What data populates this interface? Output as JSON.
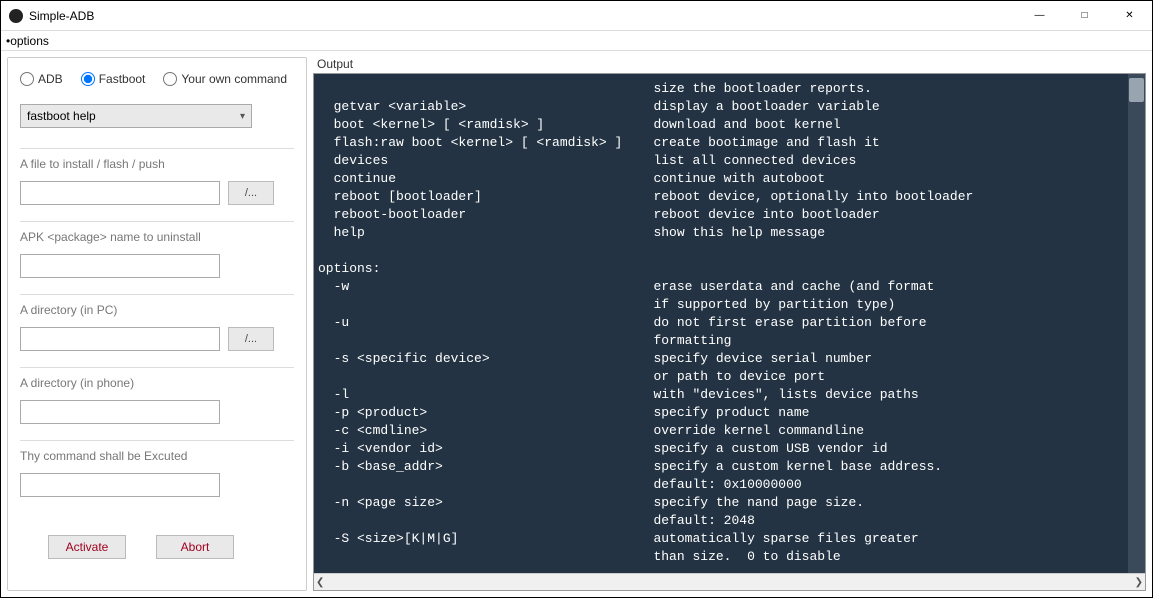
{
  "window": {
    "title": "Simple-ADB",
    "menu": "options"
  },
  "left": {
    "radios": {
      "adb": "ADB",
      "fastboot": "Fastboot",
      "own": "Your own command",
      "selected": "fastboot"
    },
    "combo": "fastboot help",
    "groups": {
      "file": {
        "label": "A file to install / flash / push",
        "browse": "/..."
      },
      "apk": {
        "label": "APK <package> name to uninstall"
      },
      "dirpc": {
        "label": "A directory (in PC)",
        "browse": "/..."
      },
      "dirphone": {
        "label": "A directory (in phone)"
      },
      "cmd": {
        "label": "Thy command shall be Excuted"
      }
    },
    "buttons": {
      "activate": "Activate",
      "abort": "Abort"
    }
  },
  "output": {
    "label": "Output",
    "text": "                                           size the bootloader reports.\n  getvar <variable>                        display a bootloader variable\n  boot <kernel> [ <ramdisk> ]              download and boot kernel\n  flash:raw boot <kernel> [ <ramdisk> ]    create bootimage and flash it\n  devices                                  list all connected devices\n  continue                                 continue with autoboot\n  reboot [bootloader]                      reboot device, optionally into bootloader\n  reboot-bootloader                        reboot device into bootloader\n  help                                     show this help message\n\noptions:\n  -w                                       erase userdata and cache (and format\n                                           if supported by partition type)\n  -u                                       do not first erase partition before\n                                           formatting\n  -s <specific device>                     specify device serial number\n                                           or path to device port\n  -l                                       with \"devices\", lists device paths\n  -p <product>                             specify product name\n  -c <cmdline>                             override kernel commandline\n  -i <vendor id>                           specify a custom USB vendor id\n  -b <base_addr>                           specify a custom kernel base address.\n                                           default: 0x10000000\n  -n <page size>                           specify the nand page size.\n                                           default: 2048\n  -S <size>[K|M|G]                         automatically sparse files greater\n                                           than size.  0 to disable"
  }
}
